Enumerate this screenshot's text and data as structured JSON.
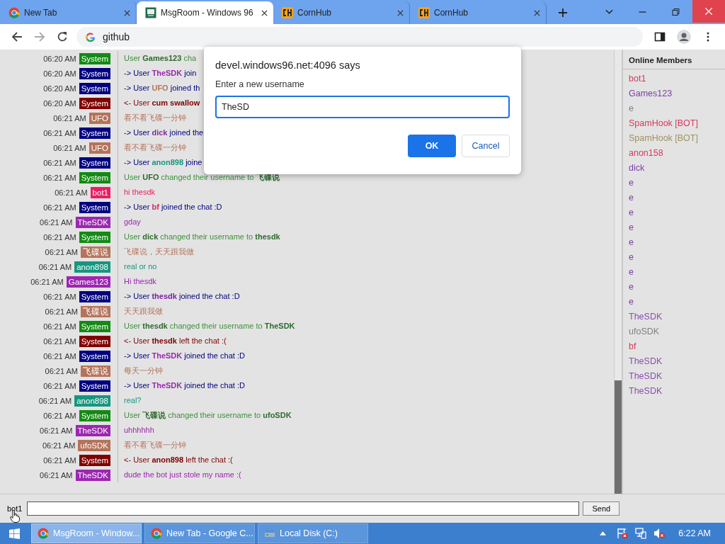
{
  "browser": {
    "tabs": [
      {
        "title": "New Tab",
        "kind": "chrome",
        "selected": false
      },
      {
        "title": "MsgRoom - Windows 96",
        "kind": "msgroom",
        "selected": true
      },
      {
        "title": "CornHub",
        "kind": "ch",
        "selected": false
      },
      {
        "title": "CornHub",
        "kind": "ch",
        "selected": false
      }
    ],
    "address": "github"
  },
  "chat": {
    "messages": [
      {
        "time": "06:20 AM",
        "user": "System",
        "color": "#138a13",
        "kind": "rename",
        "parts": [
          {
            "text": "User "
          },
          {
            "text": "Games123",
            "color": "#2f6a2f"
          },
          {
            "text": " cha"
          }
        ]
      },
      {
        "time": "06:20 AM",
        "user": "System",
        "color": "#000080",
        "kind": "join",
        "parts": [
          {
            "text": "-> User "
          },
          {
            "text": "TheSDK",
            "color": "#9c27b0"
          },
          {
            "text": " join"
          }
        ]
      },
      {
        "time": "06:20 AM",
        "user": "System",
        "color": "#000080",
        "kind": "join",
        "parts": [
          {
            "text": "-> User "
          },
          {
            "text": "UFO",
            "color": "#b5735a"
          },
          {
            "text": " joined th"
          }
        ]
      },
      {
        "time": "06:20 AM",
        "user": "System",
        "color": "#800000",
        "kind": "leave",
        "parts": [
          {
            "text": "<- User "
          },
          {
            "text": "cum swallow",
            "color": "#800000"
          }
        ]
      },
      {
        "time": "06:21 AM",
        "user": "UFO",
        "color": "#b5735a",
        "kind": "message",
        "parts": [
          {
            "text": "看不看飞碟一分钟"
          }
        ]
      },
      {
        "time": "06:21 AM",
        "user": "System",
        "color": "#000080",
        "kind": "join",
        "parts": [
          {
            "text": "-> User "
          },
          {
            "text": "dick",
            "color": "#7b2fa0"
          },
          {
            "text": " joined the"
          }
        ]
      },
      {
        "time": "06:21 AM",
        "user": "UFO",
        "color": "#b5735a",
        "kind": "message",
        "parts": [
          {
            "text": "看不看飞碟一分钟"
          }
        ]
      },
      {
        "time": "06:21 AM",
        "user": "System",
        "color": "#000080",
        "kind": "join",
        "parts": [
          {
            "text": "-> User "
          },
          {
            "text": "anon898",
            "color": "#16967f"
          },
          {
            "text": " joine"
          }
        ]
      },
      {
        "time": "06:21 AM",
        "user": "System",
        "color": "#138a13",
        "kind": "rename",
        "parts": [
          {
            "text": "User "
          },
          {
            "text": "UFO",
            "color": "#2f6a2f"
          },
          {
            "text": " changed their username to "
          },
          {
            "text": "飞碟说",
            "color": "#2f6a2f"
          }
        ]
      },
      {
        "time": "06:21 AM",
        "user": "bot1",
        "color": "#e91e63",
        "kind": "message",
        "parts": [
          {
            "text": "hi thesdk"
          }
        ]
      },
      {
        "time": "06:21 AM",
        "user": "System",
        "color": "#000080",
        "kind": "join",
        "parts": [
          {
            "text": "-> User "
          },
          {
            "text": "bf",
            "color": "#e0245e"
          },
          {
            "text": " joined the chat :D"
          }
        ]
      },
      {
        "time": "06:21 AM",
        "user": "TheSDK",
        "color": "#9c27b0",
        "kind": "message",
        "parts": [
          {
            "text": "gday"
          }
        ]
      },
      {
        "time": "06:21 AM",
        "user": "System",
        "color": "#138a13",
        "kind": "rename",
        "parts": [
          {
            "text": "User "
          },
          {
            "text": "dick",
            "color": "#2f6a2f"
          },
          {
            "text": " changed their username to "
          },
          {
            "text": "thesdk",
            "color": "#2f6a2f"
          }
        ]
      },
      {
        "time": "06:21 AM",
        "user": "飞碟说",
        "color": "#b5735a",
        "kind": "message",
        "parts": [
          {
            "text": "飞碟说，天天跟我做"
          }
        ]
      },
      {
        "time": "06:21 AM",
        "user": "anon898",
        "color": "#16967f",
        "kind": "message",
        "parts": [
          {
            "text": "real or no"
          }
        ]
      },
      {
        "time": "06:21 AM",
        "user": "Games123",
        "color": "#9c27b0",
        "kind": "message",
        "parts": [
          {
            "text": "Hi thesdk"
          }
        ]
      },
      {
        "time": "06:21 AM",
        "user": "System",
        "color": "#000080",
        "kind": "join",
        "parts": [
          {
            "text": "-> User "
          },
          {
            "text": "thesdk",
            "color": "#7b1fa2"
          },
          {
            "text": " joined the chat :D"
          }
        ]
      },
      {
        "time": "06:21 AM",
        "user": "飞碟说",
        "color": "#b5735a",
        "kind": "message",
        "parts": [
          {
            "text": "天天跟我做"
          }
        ]
      },
      {
        "time": "06:21 AM",
        "user": "System",
        "color": "#138a13",
        "kind": "rename",
        "parts": [
          {
            "text": "User "
          },
          {
            "text": "thesdk",
            "color": "#2f6a2f"
          },
          {
            "text": " changed their username to "
          },
          {
            "text": "TheSDK",
            "color": "#2f6a2f"
          }
        ]
      },
      {
        "time": "06:21 AM",
        "user": "System",
        "color": "#800000",
        "kind": "leave",
        "parts": [
          {
            "text": "<- User "
          },
          {
            "text": "thesdk",
            "color": "#800000"
          },
          {
            "text": " left the chat :("
          }
        ]
      },
      {
        "time": "06:21 AM",
        "user": "System",
        "color": "#000080",
        "kind": "join",
        "parts": [
          {
            "text": "-> User "
          },
          {
            "text": "TheSDK",
            "color": "#9c27b0"
          },
          {
            "text": " joined the chat :D"
          }
        ]
      },
      {
        "time": "06:21 AM",
        "user": "飞碟说",
        "color": "#b5735a",
        "kind": "message",
        "parts": [
          {
            "text": "每天一分钟"
          }
        ]
      },
      {
        "time": "06:21 AM",
        "user": "System",
        "color": "#000080",
        "kind": "join",
        "parts": [
          {
            "text": "-> User "
          },
          {
            "text": "TheSDK",
            "color": "#9c27b0"
          },
          {
            "text": " joined the chat :D"
          }
        ]
      },
      {
        "time": "06:21 AM",
        "user": "anon898",
        "color": "#16967f",
        "kind": "message",
        "parts": [
          {
            "text": "real?"
          }
        ]
      },
      {
        "time": "06:21 AM",
        "user": "System",
        "color": "#138a13",
        "kind": "rename",
        "parts": [
          {
            "text": "User "
          },
          {
            "text": "飞碟说",
            "color": "#2f6a2f"
          },
          {
            "text": " changed their username to "
          },
          {
            "text": "ufoSDK",
            "color": "#2f6a2f"
          }
        ]
      },
      {
        "time": "06:21 AM",
        "user": "TheSDK",
        "color": "#9c27b0",
        "kind": "message",
        "parts": [
          {
            "text": "uhhhhhh"
          }
        ]
      },
      {
        "time": "06:21 AM",
        "user": "ufoSDK",
        "color": "#b5735a",
        "kind": "message",
        "parts": [
          {
            "text": "看不看飞碟一分钟"
          }
        ]
      },
      {
        "time": "06:21 AM",
        "user": "System",
        "color": "#800000",
        "kind": "leave",
        "parts": [
          {
            "text": "<- User "
          },
          {
            "text": "anon898",
            "color": "#800000"
          },
          {
            "text": " left the chat :("
          }
        ]
      },
      {
        "time": "06:21 AM",
        "user": "TheSDK",
        "color": "#9c27b0",
        "kind": "message",
        "parts": [
          {
            "text": "dude the bot just stole my name :("
          }
        ]
      }
    ]
  },
  "members": {
    "title": "Online Members",
    "items": [
      {
        "name": "bot1",
        "color": "#d63a5a"
      },
      {
        "name": "Games123",
        "color": "#7b3fa0"
      },
      {
        "name": "e",
        "color": "#808080"
      },
      {
        "name": "SpamHook [BOT]",
        "color": "#d63a5a"
      },
      {
        "name": "SpamHook [BOT]",
        "color": "#a09060"
      },
      {
        "name": "anon158",
        "color": "#d63a5a"
      },
      {
        "name": "dick",
        "color": "#7b3fa0"
      },
      {
        "name": "e",
        "color": "#7b3fa0"
      },
      {
        "name": "e",
        "color": "#7b3fa0"
      },
      {
        "name": "e",
        "color": "#7b3fa0"
      },
      {
        "name": "e",
        "color": "#7b3fa0"
      },
      {
        "name": "e",
        "color": "#7b3fa0"
      },
      {
        "name": "e",
        "color": "#7b3fa0"
      },
      {
        "name": "e",
        "color": "#7b3fa0"
      },
      {
        "name": "e",
        "color": "#7b3fa0"
      },
      {
        "name": "e",
        "color": "#7b3fa0"
      },
      {
        "name": "TheSDK",
        "color": "#8a4fb0"
      },
      {
        "name": "ufoSDK",
        "color": "#808080"
      },
      {
        "name": "bf",
        "color": "#d63a5a"
      },
      {
        "name": "TheSDK",
        "color": "#8a4fb0"
      },
      {
        "name": "TheSDK",
        "color": "#8a4fb0"
      },
      {
        "name": "TheSDK",
        "color": "#8a4fb0"
      }
    ]
  },
  "composer": {
    "user": "bot1",
    "button": "Send"
  },
  "dialog": {
    "title": "devel.windows96.net:4096 says",
    "prompt": "Enter a new username",
    "value": "TheSD",
    "ok": "OK",
    "cancel": "Cancel"
  },
  "taskbar": {
    "items": [
      {
        "label": "MsgRoom - Window...",
        "kind": "chrome",
        "selected": true
      },
      {
        "label": "New Tab - Google C...",
        "kind": "chrome",
        "selected": false
      },
      {
        "label": "Local Disk (C:)",
        "kind": "drive",
        "selected": false
      }
    ],
    "clock": "6:22 AM"
  }
}
